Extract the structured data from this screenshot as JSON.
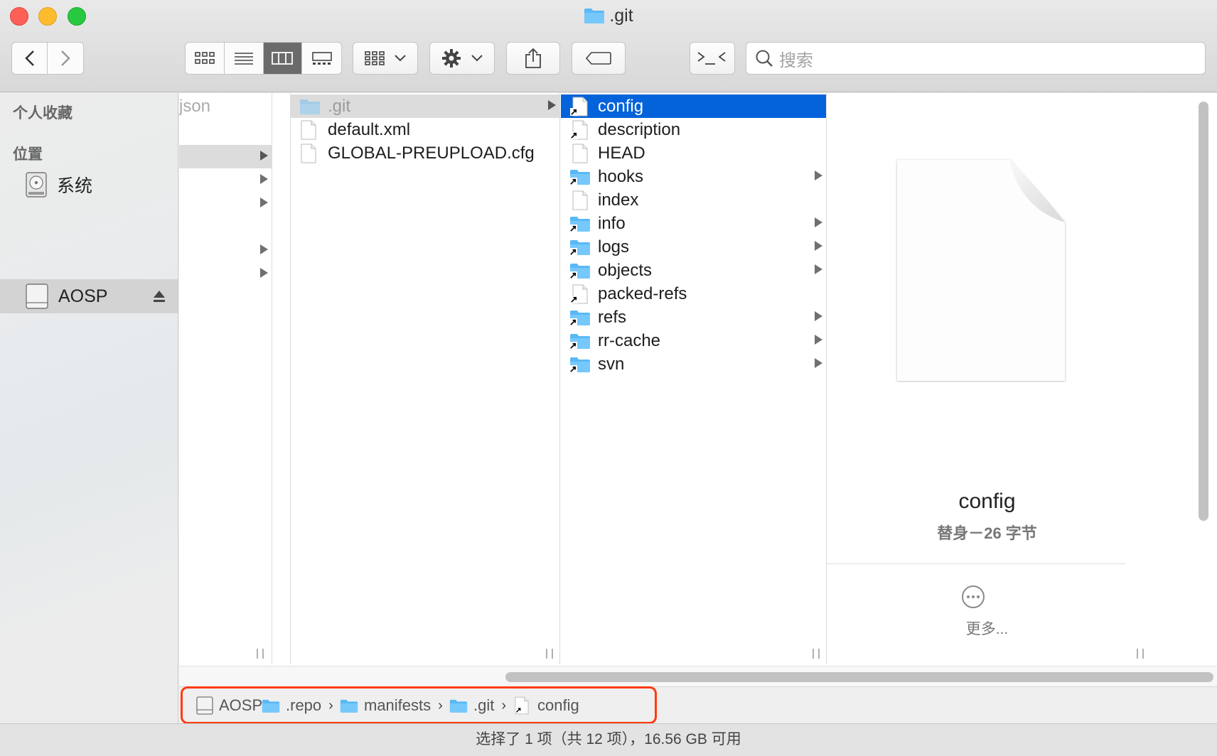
{
  "window": {
    "title": ".git"
  },
  "toolbar": {
    "search_placeholder": "搜索"
  },
  "sidebar": {
    "favorites_header": "个人收藏",
    "locations_header": "位置",
    "items": [
      {
        "label": "系统"
      },
      {
        "label": "AOSP"
      }
    ]
  },
  "columns": {
    "col1": {
      "partial_label": "json"
    },
    "col2": [
      {
        "label": ".git"
      },
      {
        "label": "default.xml"
      },
      {
        "label": "GLOBAL-PREUPLOAD.cfg"
      }
    ],
    "col3": [
      {
        "label": "config"
      },
      {
        "label": "description"
      },
      {
        "label": "HEAD"
      },
      {
        "label": "hooks"
      },
      {
        "label": "index"
      },
      {
        "label": "info"
      },
      {
        "label": "logs"
      },
      {
        "label": "objects"
      },
      {
        "label": "packed-refs"
      },
      {
        "label": "refs"
      },
      {
        "label": "rr-cache"
      },
      {
        "label": "svn"
      }
    ]
  },
  "preview": {
    "name": "config",
    "meta": "替身－26 字节",
    "more": "更多..."
  },
  "pathbar": {
    "items": [
      "AOSP",
      ".repo",
      "manifests",
      ".git",
      "config"
    ],
    "highlight_color": "#ff3b10"
  },
  "status": {
    "text": "选择了 1 项（共 12 项），16.56 GB 可用"
  },
  "colors": {
    "selection": "#0463da",
    "folder": "#5ab8f5"
  }
}
